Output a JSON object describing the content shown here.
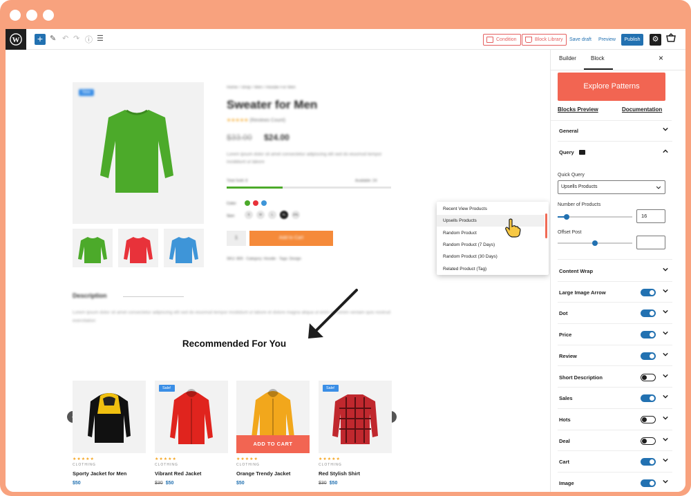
{
  "toolbar": {
    "condition_label": "Condition",
    "block_library_label": "Block Library",
    "save_draft_label": "Save draft",
    "preview_label": "Preview",
    "publish_label": "Publish"
  },
  "product": {
    "breadcrumb": "Home / Shop / Men / Hoodie For Men",
    "title": "Sweater for Men",
    "reviews": "(Reviews Count)",
    "old_price": "$33.00",
    "new_price": "$24.00",
    "desc": "Lorem ipsum dolor sit amet consectetur adipiscing elit sed do eiusmod tempor incididunt ut labore",
    "stock_label": "Total Sold: 8",
    "stock_right": "Available: 24",
    "stock_fraction": 0.34,
    "badge": "New",
    "qty": "1",
    "add_to_cart": "Add to Cart",
    "meta": "SKU: 809 · Category: Hoodie · Tags: Design",
    "color_label": "Color:",
    "size_label": "Size:",
    "sizes": [
      "S",
      "M",
      "L",
      "XL",
      "2XL"
    ]
  },
  "description": {
    "heading": "Description",
    "text": "Lorem ipsum dolor sit amet consectetur adipiscing elit sed do eiusmod tempor incididunt ut labore et dolore magna aliqua ut enim ad minim veniam quis nostrud exercitation"
  },
  "recommended": {
    "heading": "Recommended For You",
    "products": [
      {
        "title": "Sporty Jacket for Men",
        "category": "CLOTHING",
        "old_price": "",
        "price": "$50",
        "sale": "",
        "stars": "★★★★★",
        "color": "#f0c010"
      },
      {
        "title": "Vibrant Red Jacket",
        "category": "CLOTHING",
        "old_price": "$30",
        "price": "$50",
        "sale": "Sale!",
        "stars": "★★★★★",
        "color": "#e0241e"
      },
      {
        "title": "Orange Trendy Jacket",
        "category": "CLOTHING",
        "old_price": "",
        "price": "$50",
        "sale": "",
        "stars": "★★★★★",
        "color": "#f2a71c",
        "add_to_cart": "ADD TO CART"
      },
      {
        "title": "Red Stylish Shirt",
        "category": "CLOTHING",
        "old_price": "$30",
        "price": "$50",
        "sale": "Sale!",
        "stars": "★★★★★",
        "color": "#c0282e"
      }
    ]
  },
  "dropdown": {
    "items": [
      "Recent View Products",
      "Upsells Products",
      "Random Product",
      "Random Product (7 Days)",
      "Random Product (30 Days)",
      "Related Product (Tag)"
    ],
    "selected": 1
  },
  "sidebar": {
    "tabs": [
      "Builder",
      "Block"
    ],
    "active_tab": 1,
    "explore_label": "Explore Patterns",
    "blocks_preview": "Blocks Preview",
    "documentation": "Documentation",
    "general": "General",
    "query": "Query",
    "quick_query_label": "Quick Query",
    "quick_query_value": "Upsells Products",
    "num_products_label": "Number of Products",
    "num_products_value": "16",
    "num_products_fraction": 0.12,
    "offset_label": "Offset Post",
    "offset_value": "",
    "offset_fraction": 0.5,
    "toggles": [
      {
        "label": "Content Wrap",
        "toggle": null
      },
      {
        "label": "Large Image Arrow",
        "toggle": true
      },
      {
        "label": "Dot",
        "toggle": true
      },
      {
        "label": "Price",
        "toggle": true
      },
      {
        "label": "Review",
        "toggle": true
      },
      {
        "label": "Short Description",
        "toggle": false
      },
      {
        "label": "Sales",
        "toggle": true
      },
      {
        "label": "Hots",
        "toggle": false
      },
      {
        "label": "Deal",
        "toggle": false
      },
      {
        "label": "Cart",
        "toggle": true
      },
      {
        "label": "Image",
        "toggle": true
      }
    ]
  },
  "colors": {
    "accent": "#f26552",
    "wp_blue": "#2271b1",
    "frame": "#f8a27e"
  }
}
